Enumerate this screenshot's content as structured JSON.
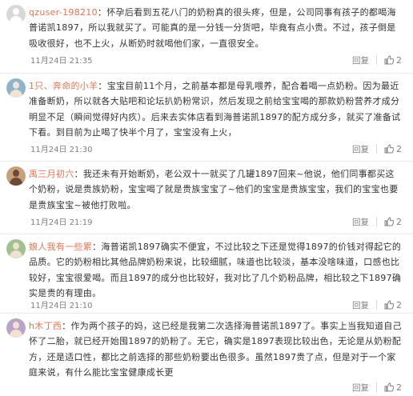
{
  "comments": [
    {
      "username": "qzuser-198210",
      "separator": "：",
      "text": "怀孕后看到五花八门的奶粉真的很头疼，但是，公司同事有孩子的都喝海普诺凯1897，所以我就买了。可能真的是一分钱一分货吧，毕竟有点小贵。不过，孩子倒是吸收很好，也不上火，从断奶时就喝他们家，一直很安全。",
      "date": "11月24日 21:35",
      "reply_label": "回复",
      "likes": "2",
      "avatar_colors": [
        "#d8d8d8",
        "#ffffff"
      ]
    },
    {
      "username": "1只、奔命的小羊",
      "separator": "：",
      "text": "宝宝目前11个月，之前基本都是母乳喂养，配合着喝一点奶粉。因为最近准备断奶，所以就各大贴吧和论坛扒奶粉常识，然后发现之前给宝宝喝的那款奶粉营养才成分明显不足（瞬间觉得好内疚）。后来去实体店看到海普诺凯1897的配方成分多，就买了准备试下看。到目前为止喝了快半个月了，宝宝没有上火，",
      "date": "11月24日 21:30",
      "reply_label": "回复",
      "likes": "2",
      "avatar_colors": [
        "#8fb3c9",
        "#f1e4d6"
      ]
    },
    {
      "username": "禹三月初六",
      "separator": "：",
      "text": "我还未有开始断奶，老公双十一就买了几罐1897回来~他说，他们同事都买这个奶粉，说是贵族奶粉，宝宝喝了就是贵族宝宝了~他们的宝宝是贵族宝宝，我们的宝宝也要是贵族宝宝~被他打败啦。",
      "date": "11月24日 21:19",
      "reply_label": "回复",
      "likes": "2",
      "avatar_colors": [
        "#c9a07c",
        "#6b4a36"
      ]
    },
    {
      "username": "娘人我有一些累",
      "separator": "：",
      "text": "海普诺凯1897确实不便宜，不过比较之下还是觉得1897的价钱对得起它的品质。它的奶粉相比其他品牌奶粉来说，比较细腻，味道也比较淡，基本没啥味道，口感也比较好，宝宝很爱喝。而且1897的成分也比较好，我对比了几个奶粉品牌，相比较之下1897确实是贵的有理由。",
      "date": "11月24日 21:10",
      "reply_label": "回复",
      "likes": "2",
      "avatar_colors": [
        "#9fc28e",
        "#f0e0d0"
      ]
    },
    {
      "username": "h木丁西",
      "separator": "：",
      "text": "作为两个孩子的妈，这已经是我第二次选择海普诺凯1897了。事实上当我知道自己怀了二胎，就已经开始囤1897的奶粉了。无它，确实是1897表现比较出色，无论是从奶粉配方，还是适口性，都比之前选择的那些奶粉要出色很多。虽然1897贵了点，但是对于一个家庭来说，有什么能比宝宝健康成长更",
      "date": "",
      "reply_label": "回复",
      "likes": "2",
      "avatar_colors": [
        "#b9a3c9",
        "#f3e2d2"
      ]
    }
  ]
}
